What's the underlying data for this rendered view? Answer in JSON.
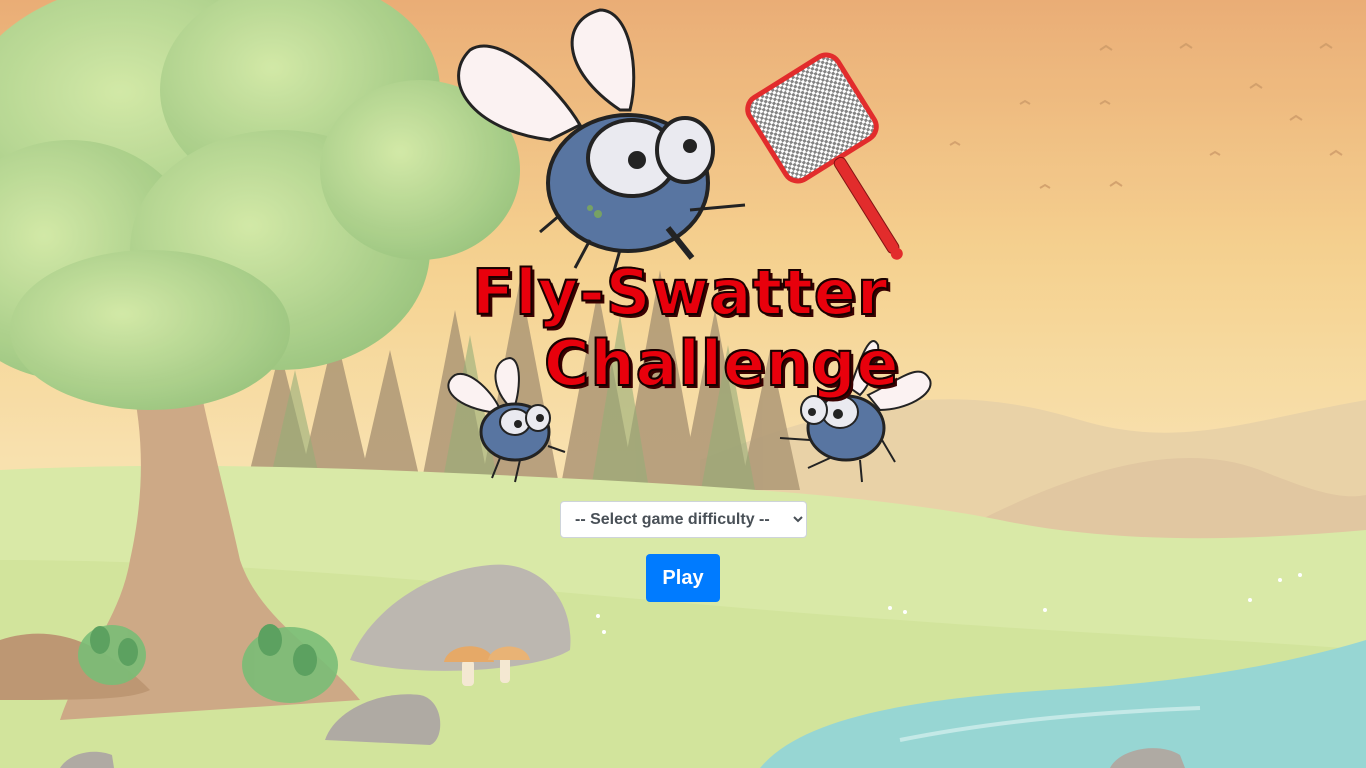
{
  "game": {
    "title_line1": "Fly-Swatter",
    "title_line2": "Challenge"
  },
  "difficulty": {
    "selected": "-- Select game difficulty --",
    "options": [
      "-- Select game difficulty --"
    ]
  },
  "play_button": {
    "label": "Play"
  },
  "colors": {
    "title_red": "#e8000c",
    "play_button_blue": "#007bff",
    "sky_top": "#f1c27d",
    "grass": "#cfe49a",
    "water": "#8fd3d0"
  },
  "icons": [
    "fly-icon",
    "fly-swatter-icon",
    "tree-icon",
    "rock-icon",
    "mushroom-icon",
    "bird-icon"
  ]
}
